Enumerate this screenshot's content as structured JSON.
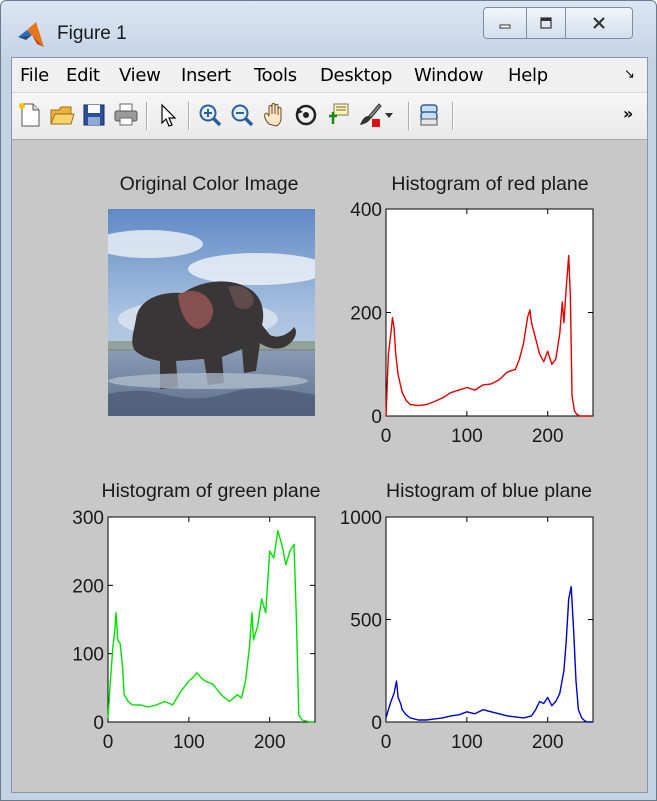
{
  "window": {
    "title": "Figure 1",
    "app_icon": "matlab-icon",
    "controls": [
      "minimize-icon",
      "maximize-icon",
      "close-icon"
    ]
  },
  "menu": [
    "File",
    "Edit",
    "View",
    "Insert",
    "Tools",
    "Desktop",
    "Window",
    "Help"
  ],
  "toolbar": {
    "icons": [
      "new-figure-icon",
      "open-file-icon",
      "save-icon",
      "print-icon",
      "pointer-icon",
      "zoom-in-icon",
      "zoom-out-icon",
      "pan-hand-icon",
      "rotate-3d-icon",
      "data-cursor-icon",
      "brush-icon",
      "brush-dropdown-icon",
      "link-plot-icon"
    ],
    "overflow": "»"
  },
  "panels": {
    "image_title": "Original Color Image",
    "red_title": "Histogram of red plane",
    "green_title": "Histogram of green plane",
    "blue_title": "Histogram of blue plane"
  },
  "chart_data": [
    {
      "type": "line",
      "title": "Histogram of red plane",
      "color": "#e00000",
      "xlim": [
        0,
        256
      ],
      "ylim": [
        0,
        400
      ],
      "xticks": [
        0,
        100,
        200
      ],
      "yticks": [
        0,
        200,
        400
      ],
      "x": [
        0,
        3,
        6,
        8,
        10,
        12,
        15,
        20,
        25,
        30,
        40,
        50,
        60,
        70,
        80,
        90,
        100,
        110,
        120,
        130,
        140,
        150,
        160,
        165,
        170,
        175,
        178,
        180,
        185,
        190,
        195,
        200,
        205,
        210,
        215,
        218,
        220,
        223,
        226,
        228,
        230,
        233,
        236,
        240,
        245,
        250,
        255
      ],
      "y": [
        0,
        120,
        160,
        190,
        170,
        120,
        80,
        45,
        30,
        22,
        20,
        22,
        28,
        35,
        45,
        50,
        55,
        50,
        60,
        62,
        70,
        85,
        90,
        110,
        140,
        190,
        205,
        180,
        150,
        120,
        105,
        125,
        100,
        110,
        160,
        220,
        180,
        250,
        310,
        230,
        40,
        10,
        3,
        0,
        0,
        0,
        0
      ]
    },
    {
      "type": "line",
      "title": "Histogram of green plane",
      "color": "#00e000",
      "xlim": [
        0,
        256
      ],
      "ylim": [
        0,
        300
      ],
      "xticks": [
        0,
        100,
        200
      ],
      "yticks": [
        0,
        100,
        200,
        300
      ],
      "x": [
        0,
        3,
        6,
        8,
        10,
        12,
        15,
        18,
        20,
        25,
        30,
        40,
        50,
        60,
        70,
        80,
        90,
        100,
        105,
        110,
        115,
        120,
        130,
        140,
        150,
        160,
        165,
        170,
        175,
        178,
        180,
        185,
        190,
        195,
        200,
        205,
        210,
        215,
        220,
        225,
        230,
        233,
        236,
        240,
        250,
        255
      ],
      "y": [
        5,
        60,
        110,
        130,
        160,
        120,
        115,
        80,
        40,
        30,
        25,
        25,
        22,
        25,
        30,
        25,
        45,
        60,
        65,
        72,
        65,
        60,
        55,
        40,
        30,
        40,
        35,
        60,
        110,
        160,
        120,
        140,
        180,
        160,
        250,
        240,
        280,
        260,
        230,
        250,
        260,
        150,
        10,
        3,
        0,
        0
      ]
    },
    {
      "type": "line",
      "title": "Histogram of blue plane",
      "color": "#0000cc",
      "xlim": [
        0,
        256
      ],
      "ylim": [
        0,
        1000
      ],
      "xticks": [
        0,
        100,
        200
      ],
      "yticks": [
        0,
        500,
        1000
      ],
      "x": [
        0,
        3,
        6,
        10,
        13,
        15,
        18,
        20,
        25,
        30,
        40,
        50,
        60,
        70,
        80,
        90,
        100,
        110,
        120,
        130,
        140,
        150,
        160,
        170,
        180,
        185,
        190,
        195,
        200,
        205,
        210,
        215,
        220,
        223,
        226,
        229,
        232,
        235,
        238,
        242,
        246,
        250,
        255
      ],
      "y": [
        20,
        60,
        100,
        140,
        200,
        120,
        90,
        60,
        35,
        20,
        10,
        10,
        15,
        20,
        30,
        35,
        50,
        40,
        60,
        50,
        40,
        30,
        25,
        20,
        30,
        60,
        100,
        90,
        120,
        80,
        100,
        140,
        250,
        400,
        600,
        660,
        450,
        200,
        60,
        20,
        5,
        0,
        0
      ]
    }
  ]
}
